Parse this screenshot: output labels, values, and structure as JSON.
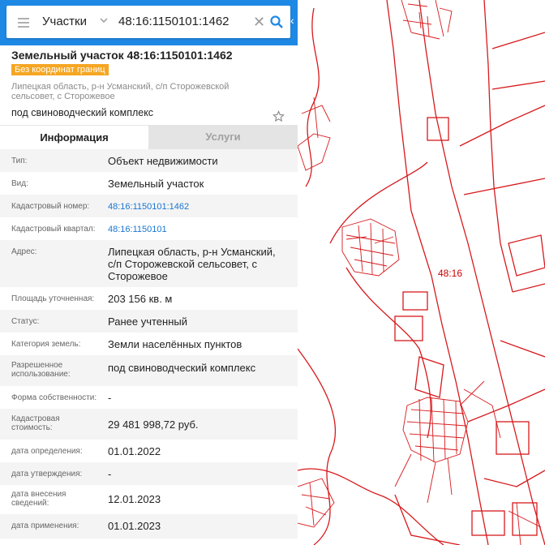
{
  "search": {
    "type_value": "Участки",
    "query": "48:16:1150101:1462"
  },
  "parcel": {
    "title": "Земельный участок 48:16:1150101:1462",
    "badge": "Без координат границ",
    "address_short": "Липецкая область, р-н Усманский, с/п Сторожевской сельсовет, с Сторожевое",
    "purpose": "под свиноводческий комплекс"
  },
  "tabs": {
    "info": "Информация",
    "services": "Услуги"
  },
  "rows": [
    {
      "label": "Тип:",
      "value": "Объект недвижимости"
    },
    {
      "label": "Вид:",
      "value": "Земельный участок"
    },
    {
      "label": "Кадастровый номер:",
      "value": "48:16:1150101:1462"
    },
    {
      "label": "Кадастровый квартал:",
      "value": "48:16:1150101"
    },
    {
      "label": "Адрес:",
      "value": "Липецкая область, р-н Усманский, с/п Сторожевской сельсовет, с Сторожевое"
    },
    {
      "label": "Площадь уточненная:",
      "value": "203 156 кв. м"
    },
    {
      "label": "Статус:",
      "value": "Ранее учтенный"
    },
    {
      "label": "Категория земель:",
      "value": "Земли населённых пунктов"
    },
    {
      "label": "Разрешенное использование:",
      "value": "под свиноводческий комплекс"
    },
    {
      "label": "Форма собственности:",
      "value": "-"
    },
    {
      "label": "Кадастровая стоимость:",
      "value": "29 481 998,72 руб."
    },
    {
      "label": "дата определения:",
      "value": "01.01.2022"
    },
    {
      "label": "дата утверждения:",
      "value": "-"
    },
    {
      "label": "дата внесения сведений:",
      "value": "12.01.2023"
    },
    {
      "label": "дата применения:",
      "value": "01.01.2023"
    }
  ],
  "map": {
    "label": "48:16",
    "line_color": "#d7191c"
  },
  "colors": {
    "header": "#1e88e5",
    "badge": "#f5a623",
    "link": "#1976d2"
  },
  "icons": [
    "menu-icon",
    "chevron-down-icon",
    "close-icon",
    "search-icon",
    "chevron-left-icon",
    "star-icon"
  ]
}
